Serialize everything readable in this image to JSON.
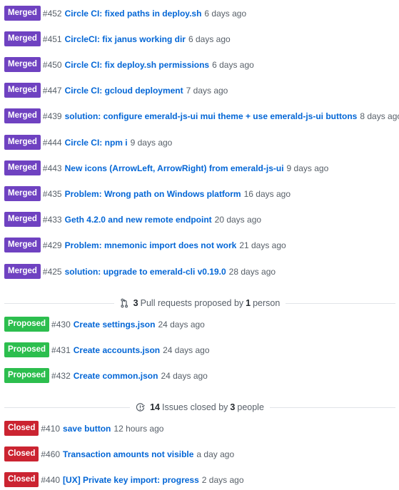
{
  "merged_pull_requests": [
    {
      "state": "Merged",
      "number": "#452",
      "title": "Circle CI: fixed paths in deploy.sh",
      "time": "6 days ago"
    },
    {
      "state": "Merged",
      "number": "#451",
      "title": "CircleCI: fix janus working dir",
      "time": "6 days ago"
    },
    {
      "state": "Merged",
      "number": "#450",
      "title": "Circle CI: fix deploy.sh permissions",
      "time": "6 days ago"
    },
    {
      "state": "Merged",
      "number": "#447",
      "title": "Circle CI: gcloud deployment",
      "time": "7 days ago"
    },
    {
      "state": "Merged",
      "number": "#439",
      "title": "solution: configure emerald-js-ui mui theme + use emerald-js-ui buttons",
      "time": "8 days ago"
    },
    {
      "state": "Merged",
      "number": "#444",
      "title": "Circle CI: npm i",
      "time": "9 days ago"
    },
    {
      "state": "Merged",
      "number": "#443",
      "title": "New icons (ArrowLeft, ArrowRight) from emerald-js-ui",
      "time": "9 days ago"
    },
    {
      "state": "Merged",
      "number": "#435",
      "title": "Problem: Wrong path on Windows platform",
      "time": "16 days ago"
    },
    {
      "state": "Merged",
      "number": "#433",
      "title": "Geth 4.2.0 and new remote endpoint",
      "time": "20 days ago"
    },
    {
      "state": "Merged",
      "number": "#429",
      "title": "Problem: mnemonic import does not work",
      "time": "21 days ago"
    },
    {
      "state": "Merged",
      "number": "#425",
      "title": "solution: upgrade to emerald-cli v0.19.0",
      "time": "28 days ago"
    }
  ],
  "proposed_section": {
    "icon": "git-pull-request-icon",
    "count": "3",
    "text_middle": "Pull requests proposed by",
    "people": "1",
    "text_end": "person"
  },
  "proposed_pull_requests": [
    {
      "state": "Proposed",
      "number": "#430",
      "title": "Create settings.json",
      "time": "24 days ago"
    },
    {
      "state": "Proposed",
      "number": "#431",
      "title": "Create accounts.json",
      "time": "24 days ago"
    },
    {
      "state": "Proposed",
      "number": "#432",
      "title": "Create common.json",
      "time": "24 days ago"
    }
  ],
  "closed_section": {
    "icon": "issue-closed-icon",
    "count": "14",
    "text_middle": "Issues closed by",
    "people": "3",
    "text_end": "people"
  },
  "closed_issues": [
    {
      "state": "Closed",
      "number": "#410",
      "title": "save button",
      "time": "12 hours ago"
    },
    {
      "state": "Closed",
      "number": "#460",
      "title": "Transaction amounts not visible",
      "time": "a day ago"
    },
    {
      "state": "Closed",
      "number": "#440",
      "title": "[UX] Private key import: progress",
      "time": "2 days ago"
    }
  ],
  "colors": {
    "merged": "#6f42c1",
    "proposed": "#2cbe4e",
    "closed": "#cb2431",
    "link": "#0366d6",
    "muted": "#586069"
  }
}
